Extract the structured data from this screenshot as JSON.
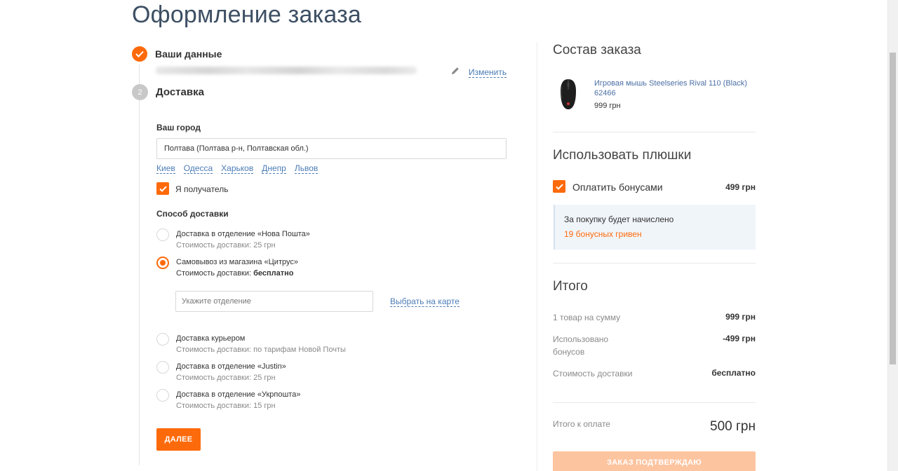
{
  "page": {
    "title": "Оформление заказа"
  },
  "step1": {
    "title": "Ваши данные",
    "change_label": "Изменить"
  },
  "step2": {
    "number": "2",
    "title": "Доставка",
    "city_label": "Ваш город",
    "city_value": "Полтава (Полтава р-н, Полтавская обл.)",
    "quick_cities": [
      "Киев",
      "Одесса",
      "Харьков",
      "Днепр",
      "Львов"
    ],
    "recipient_label": "Я получатель",
    "delivery_label": "Способ доставки",
    "options": [
      {
        "title": "Доставка в отделение «Нова Пошта»",
        "sub": "Стоимость доставки: 25 грн",
        "selected": false
      },
      {
        "title": "Самовывоз из магазина «Цитрус»",
        "sub_prefix": "Стоимость доставки:",
        "sub_bold": "бесплатно",
        "selected": true
      },
      {
        "title": "Доставка курьером",
        "sub": "Стоимость доставки: по тарифам Новой Почты",
        "selected": false
      },
      {
        "title": "Доставка в отделение «Justin»",
        "sub": "Стоимость доставки: 25 грн",
        "selected": false
      },
      {
        "title": "Доставка в отделение «Укрпошта»",
        "sub": "Стоимость доставки: 15 грн",
        "selected": false
      }
    ],
    "branch_placeholder": "Укажите отделение",
    "map_link": "Выбрать на карте",
    "next_label": "ДАЛЕЕ"
  },
  "order": {
    "title": "Состав заказа",
    "product_name": "Игровая мышь Steelseries Rival 110 (Black) 62466",
    "product_price": "999 грн"
  },
  "bonus": {
    "title": "Использовать плюшки",
    "pay_label": "Оплатить бонусами",
    "pay_amount": "499 грн",
    "info_text": "За покупку будет начислено",
    "info_accent": "19 бонусных гривен"
  },
  "total": {
    "title": "Итого",
    "rows": [
      {
        "label": "1 товар на сумму",
        "value": "999 грн"
      },
      {
        "label": "Использовано бонусов",
        "value": "-499 грн"
      },
      {
        "label": "Стоимость доставки",
        "value": "бесплатно"
      }
    ],
    "pay_label": "Итого к оплате",
    "pay_value": "500 грн",
    "confirm_label": "ЗАКАЗ ПОДТВЕРЖДАЮ"
  },
  "colors": {
    "accent": "#fd6a0b",
    "link": "#4b7cb6",
    "title": "#3d4f63"
  }
}
